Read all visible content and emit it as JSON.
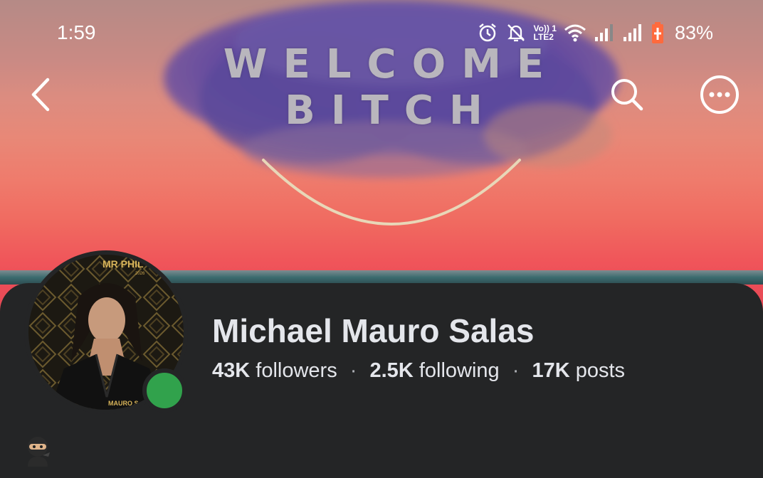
{
  "status_bar": {
    "time": "1:59",
    "network_label_1": "Vo)) 1",
    "network_label_2": "LTE2",
    "battery": "83%"
  },
  "cover": {
    "line1": "WELCOME",
    "line2": "BITCH"
  },
  "avatar": {
    "badge_text": "MR PHIL",
    "badge_year": "2026",
    "caption": "MAURO S"
  },
  "profile": {
    "name": "Michael Mauro Salas",
    "followers_count": "43K",
    "followers_label": "followers",
    "following_count": "2.5K",
    "following_label": "following",
    "posts_count": "17K",
    "posts_label": "posts",
    "separator": "·"
  },
  "icons": {
    "back": "chevron-left-icon",
    "search": "search-icon",
    "more": "more-options-icon",
    "alarm": "alarm-icon",
    "mute": "bell-off-icon",
    "wifi": "wifi-icon",
    "signal": "signal-icon",
    "battery": "battery-charging-icon",
    "online": "online-status-dot",
    "ninja": "ninja-emoji-icon"
  },
  "colors": {
    "panel_bg": "#242526",
    "text": "#e4e6eb",
    "online": "#31a24c"
  }
}
